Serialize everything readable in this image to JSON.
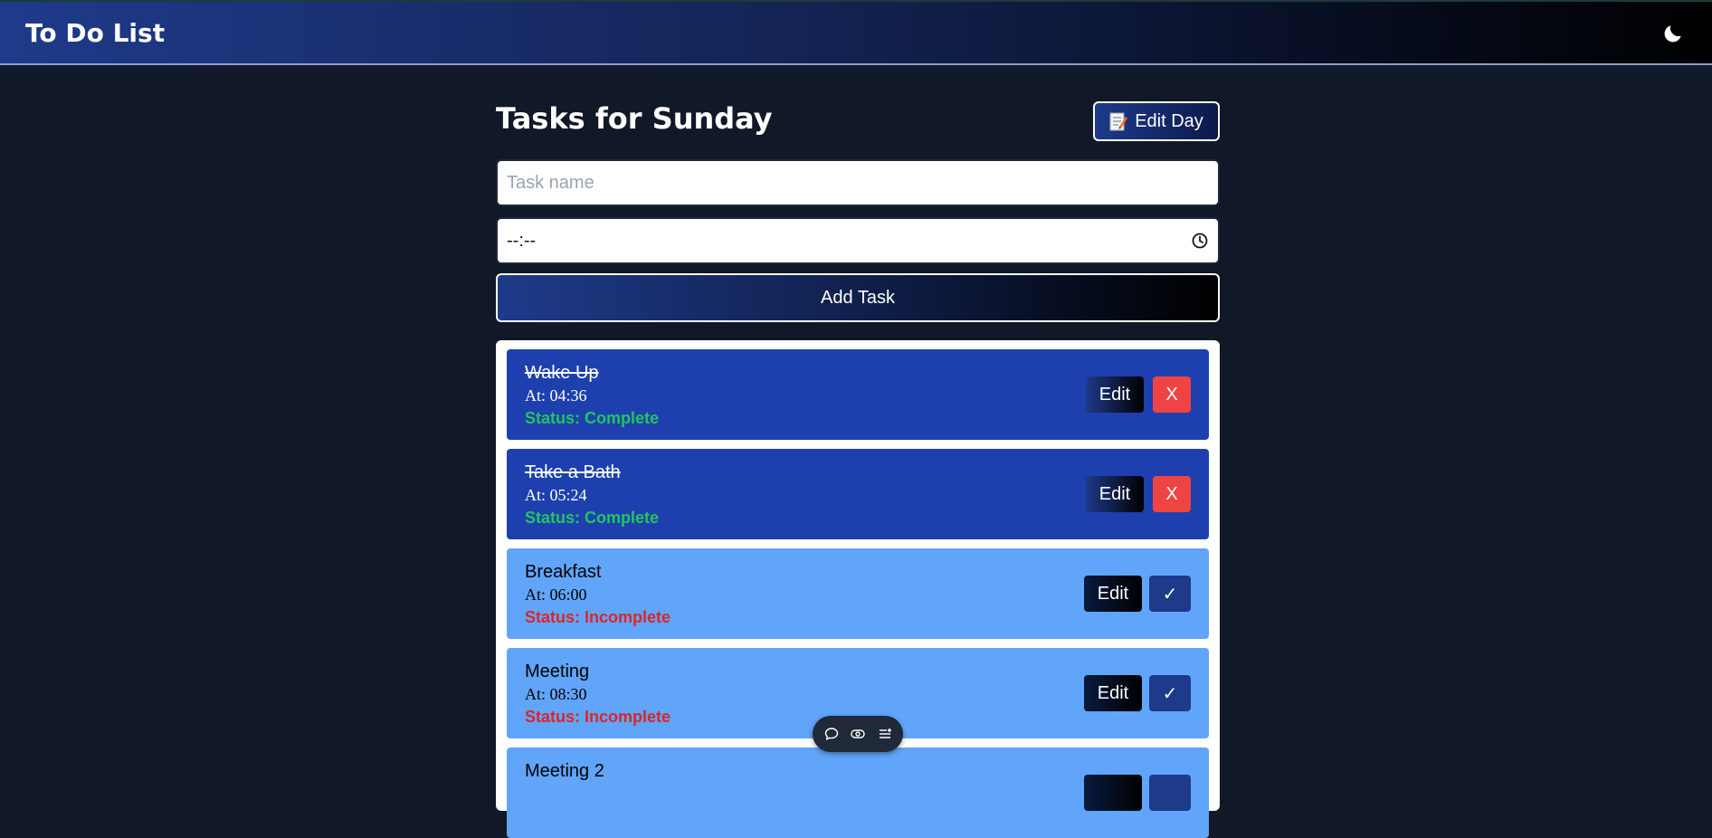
{
  "app": {
    "title": "To Do List"
  },
  "header": {
    "theme_toggle_icon": "moon-icon"
  },
  "page": {
    "title": "Tasks for Sunday",
    "edit_day_label": "Edit Day",
    "edit_day_icon": "memo-icon"
  },
  "form": {
    "task_name_placeholder": "Task name",
    "task_name_value": "",
    "time_value": "--:--",
    "time_icon": "clock-icon",
    "add_task_label": "Add Task"
  },
  "tasks": [
    {
      "name": "Wake Up",
      "time": "At: 04:36",
      "status": "Status: Complete",
      "complete": true,
      "edit_label": "Edit",
      "action_label": "X"
    },
    {
      "name": "Take a Bath",
      "time": "At: 05:24",
      "status": "Status: Complete",
      "complete": true,
      "edit_label": "Edit",
      "action_label": "X"
    },
    {
      "name": "Breakfast",
      "time": "At: 06:00",
      "status": "Status: Incomplete",
      "complete": false,
      "edit_label": "Edit",
      "action_label": "✓"
    },
    {
      "name": "Meeting",
      "time": "At: 08:30",
      "status": "Status: Incomplete",
      "complete": false,
      "edit_label": "Edit",
      "action_label": "✓"
    },
    {
      "name": "Meeting 2",
      "time": "",
      "status": "",
      "complete": false,
      "edit_label": "",
      "action_label": ""
    }
  ],
  "floating_toolbar": {
    "icons": [
      "comment-icon",
      "eye-icon",
      "list-icon"
    ]
  },
  "colors": {
    "complete_bg": "#1e40af",
    "incomplete_bg": "#60a5fa",
    "status_complete": "#22c55e",
    "status_incomplete": "#dc2626",
    "delete": "#ef4444",
    "page_bg": "#111827"
  }
}
